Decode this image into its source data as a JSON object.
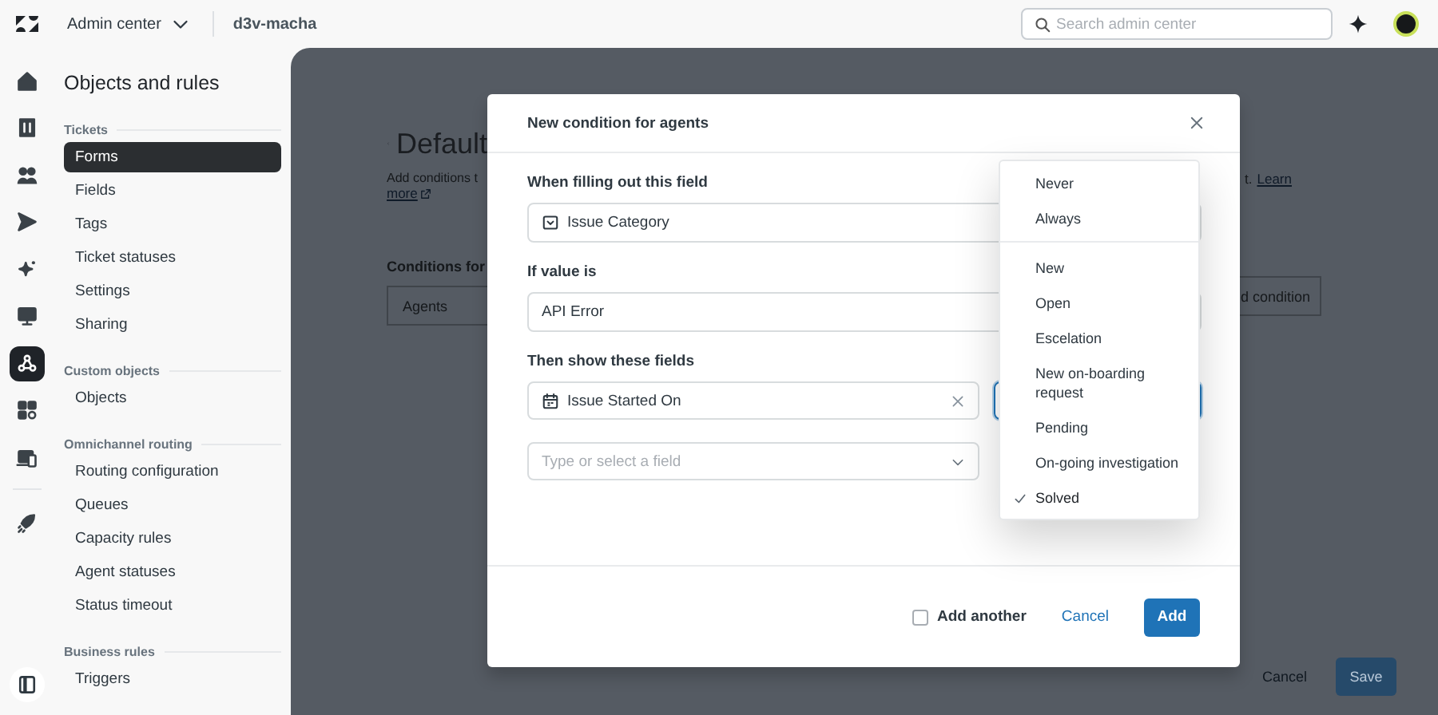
{
  "top_bar": {
    "product": "Admin center",
    "account": "d3v-macha",
    "search": {
      "placeholder": "Search admin center"
    }
  },
  "rail": {
    "main": [
      {
        "kind": "home",
        "selected": false
      },
      {
        "kind": "building",
        "selected": false
      },
      {
        "kind": "people",
        "selected": false
      },
      {
        "kind": "send",
        "selected": false
      },
      {
        "kind": "sparkle",
        "selected": false
      },
      {
        "kind": "monitor",
        "selected": false
      },
      {
        "kind": "objects",
        "selected": true
      },
      {
        "kind": "apps",
        "selected": false
      },
      {
        "kind": "device",
        "selected": false
      }
    ],
    "extra": [
      {
        "kind": "rocket",
        "selected": false
      }
    ],
    "bottom": [
      {
        "kind": "panel",
        "selected": false
      }
    ]
  },
  "sidebar": {
    "title": "Objects and rules",
    "sections": [
      {
        "heading": "Tickets",
        "items": [
          {
            "label": "Forms",
            "selected": true
          },
          {
            "label": "Fields",
            "selected": false
          },
          {
            "label": "Tags",
            "selected": false
          },
          {
            "label": "Ticket statuses",
            "selected": false
          },
          {
            "label": "Settings",
            "selected": false
          },
          {
            "label": "Sharing",
            "selected": false
          }
        ]
      },
      {
        "heading": "Custom objects",
        "items": [
          {
            "label": "Objects",
            "selected": false
          }
        ]
      },
      {
        "heading": "Omnichannel routing",
        "items": [
          {
            "label": "Routing configuration",
            "selected": false
          },
          {
            "label": "Queues",
            "selected": false
          },
          {
            "label": "Capacity rules",
            "selected": false
          },
          {
            "label": "Agent statuses",
            "selected": false
          },
          {
            "label": "Status timeout",
            "selected": false
          }
        ]
      },
      {
        "heading": "Business rules",
        "items": [
          {
            "label": "Triggers",
            "selected": false
          }
        ]
      }
    ]
  },
  "page": {
    "title": "Default",
    "description": "Add conditions t",
    "link": "more",
    "description_right": "t.",
    "link_right": "Learn",
    "section_heading": "Conditions for",
    "tab": "Agents",
    "add_button": "d condition",
    "cancel": "Cancel",
    "save": "Save"
  },
  "dialog": {
    "title": "New condition for agents",
    "fields": [
      {
        "label": "When filling out this field",
        "value": "Issue Category",
        "kind": "dropdown"
      },
      {
        "label": "If value is",
        "value": "API Error",
        "kind": "plain"
      }
    ],
    "show": {
      "label": "Then show these fields",
      "selected_fields": [
        {
          "value": "Issue Started On",
          "kind": "date"
        }
      ],
      "placeholder": "Type or select a field"
    },
    "add_another": {
      "label": "Add another",
      "checked": false
    },
    "cancel": "Cancel",
    "confirm": "Add"
  },
  "dropdown": {
    "groups": [
      [
        {
          "label": "Never",
          "selected": false
        },
        {
          "label": "Always",
          "selected": false
        }
      ],
      [
        {
          "label": "New",
          "selected": false
        },
        {
          "label": "Open",
          "selected": false
        },
        {
          "label": "Escelation",
          "selected": false
        },
        {
          "label": "New on-boarding request",
          "selected": false
        },
        {
          "label": "Pending",
          "selected": false
        },
        {
          "label": "On-going investigation",
          "selected": false
        },
        {
          "label": "Solved",
          "selected": true
        }
      ]
    ]
  }
}
